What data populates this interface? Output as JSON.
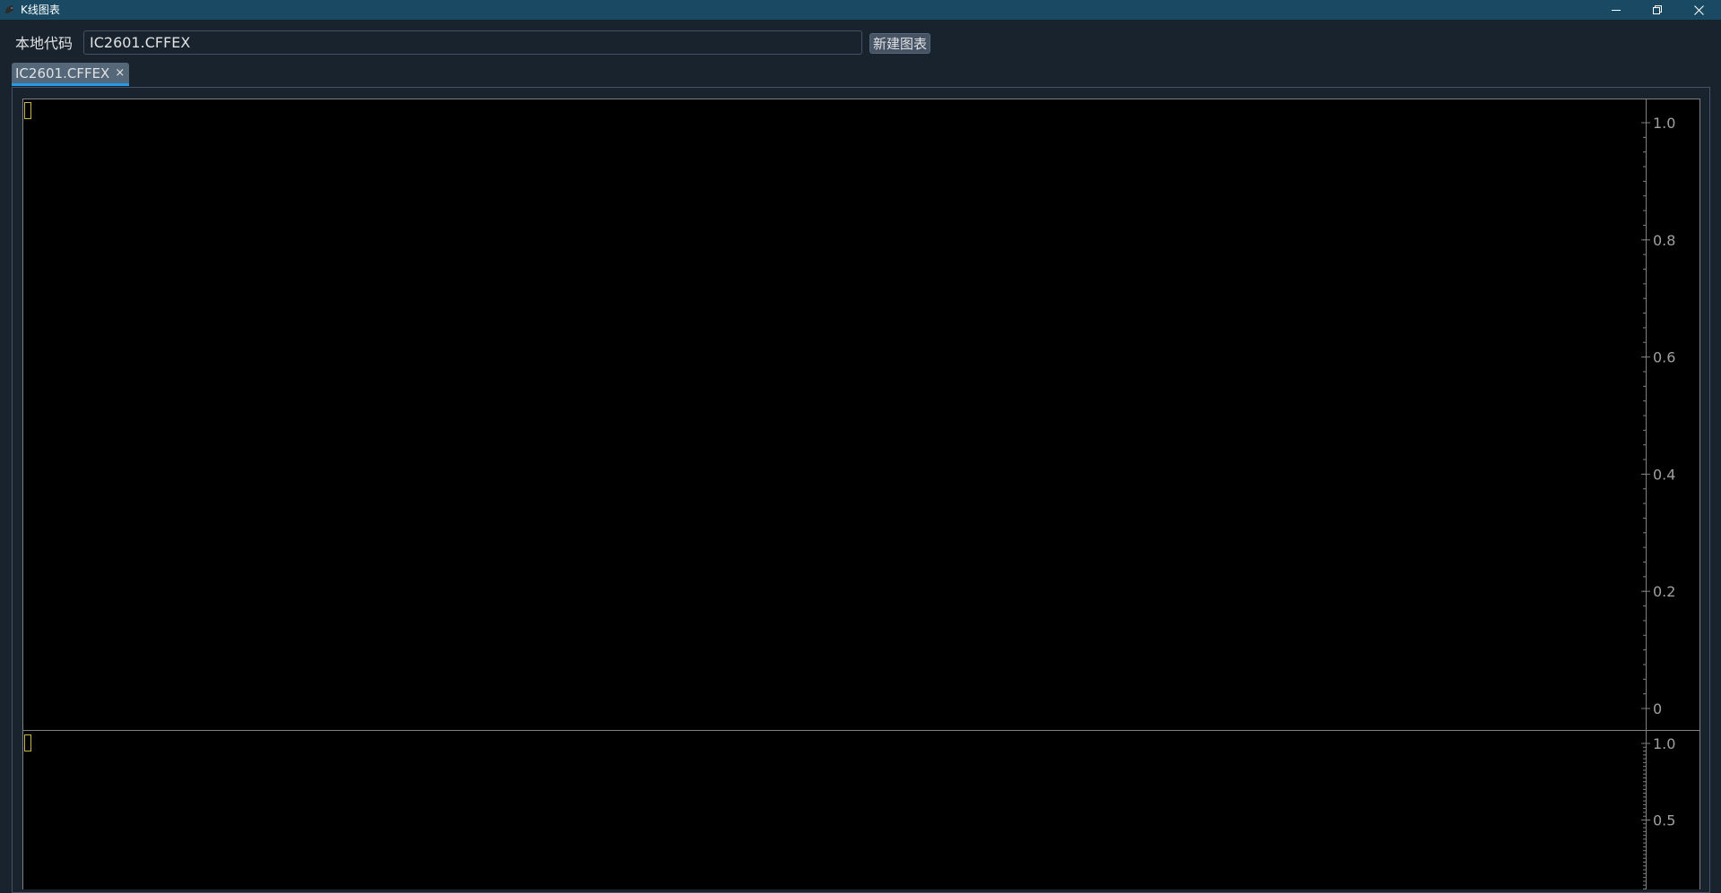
{
  "window": {
    "title": "K线图表",
    "minimize_icon": "minimize-icon",
    "restore_icon": "restore-icon",
    "close_icon": "close-icon"
  },
  "toolbar": {
    "code_label": "本地代码",
    "code_value": "IC2601.CFFEX",
    "new_chart_label": "新建图表"
  },
  "tabs": [
    {
      "label": "IC2601.CFFEX",
      "close_symbol": "×",
      "active": true
    }
  ],
  "colors": {
    "background": "#000000",
    "axis_text": "#a0a0a0",
    "grid_line": "#808080",
    "cursor_box": "#c8b450",
    "tab_accent": "#259ae9"
  },
  "chart_data": [
    {
      "type": "line",
      "series": [],
      "ylim": [
        0,
        1.0
      ],
      "ytick_labels": [
        "1.0",
        "0.8",
        "0.6",
        "0.4",
        "0.2",
        "0"
      ],
      "ytick_values": [
        1.0,
        0.8,
        0.6,
        0.4,
        0.2,
        0
      ],
      "legend": "none"
    },
    {
      "type": "bar",
      "series": [],
      "ylim": [
        0,
        1.0
      ],
      "ytick_labels": [
        "1.0",
        "0.5"
      ],
      "ytick_values": [
        1.0,
        0.5
      ],
      "legend": "none"
    }
  ]
}
